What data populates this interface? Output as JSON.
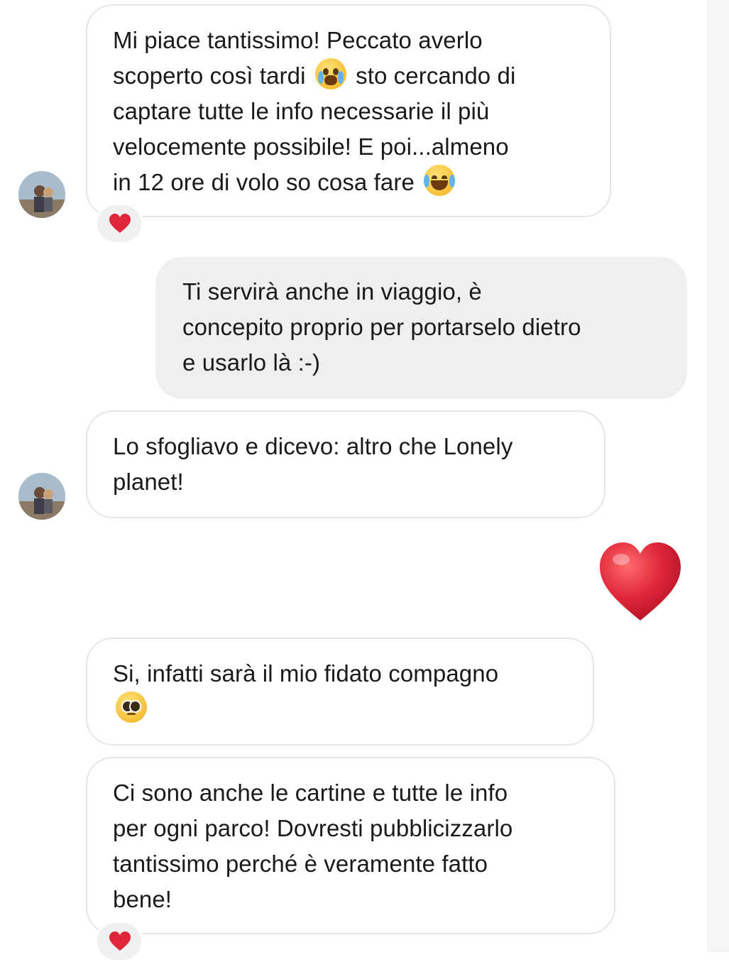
{
  "thread": {
    "messages": [
      {
        "direction": "incoming",
        "lines": [
          "Mi piace tantissimo! Peccato averlo",
          "scoperto così tardi",
          "sto cercando di",
          "captare tutte le info necessarie il più",
          "velocemente possibile! E poi...almeno",
          "in 12 ore di volo so cosa fare"
        ],
        "emojis": [
          "loudly-crying-face",
          "face-with-tears-of-joy"
        ],
        "reaction": "red-heart"
      },
      {
        "direction": "outgoing",
        "lines": [
          "Ti servirà anche in viaggio, è",
          "concepito proprio per portarselo dietro",
          "e usarlo là :-)"
        ]
      },
      {
        "direction": "incoming",
        "lines": [
          "Lo sfogliavo e dicevo: altro che Lonely",
          "planet!"
        ]
      },
      {
        "direction": "outgoing",
        "type": "emoji",
        "emoji": "red-heart"
      },
      {
        "direction": "incoming",
        "lines": [
          "Si, infatti sarà il mio fidato compagno"
        ],
        "emojis": [
          "pleading-face"
        ]
      },
      {
        "direction": "incoming",
        "lines": [
          "Ci sono anche le cartine e tutte le info",
          "per ogni parco! Dovresti pubblicizzarlo",
          "tantissimo perché è veramente fatto",
          "bene!"
        ],
        "reaction": "red-heart"
      }
    ]
  },
  "colors": {
    "incoming_bubble_border": "#e6e6e6",
    "outgoing_bubble_bg": "#efefef",
    "heart": "#e0263a",
    "text": "#1a1a1a"
  }
}
